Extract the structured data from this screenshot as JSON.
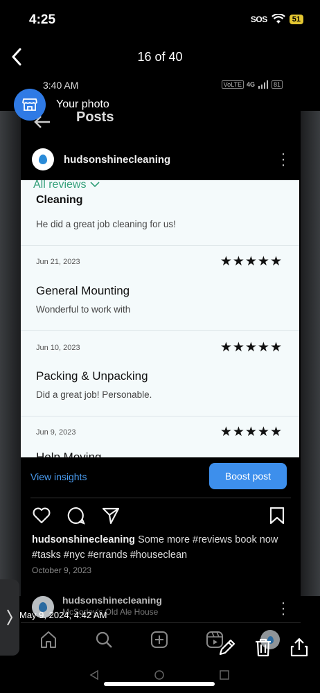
{
  "ios_status": {
    "time": "4:25",
    "sos": "SOS",
    "battery": "51"
  },
  "viewer": {
    "counter": "16 of 40"
  },
  "your_photo": {
    "label": "Your photo"
  },
  "screenshot": {
    "status_time": "3:40 AM",
    "status_icons": [
      "VoLTE",
      "4G",
      "81"
    ],
    "posts_title": "Posts",
    "profile_name": "hudsonshinecleaning",
    "reviews": {
      "tab_label": "All reviews",
      "clipped_title": "Cleaning",
      "first_text": "He did a great job cleaning for us!",
      "items": [
        {
          "date": "Jun 21, 2023",
          "stars": "★★★★★",
          "title": "General Mounting",
          "text": "Wonderful to work with"
        },
        {
          "date": "Jun 10, 2023",
          "stars": "★★★★★",
          "title": "Packing & Unpacking",
          "text": "Did a great job! Personable."
        },
        {
          "date": "Jun 9, 2023",
          "stars": "★★★★★",
          "title": "Help Moving",
          "text": ""
        }
      ]
    },
    "view_insights": "View insights",
    "boost_post": "Boost post",
    "caption_user": "hudsonshinecleaning",
    "caption_text": " Some more #reviews book now #tasks #nyc #errands #houseclean",
    "post_date": "October 9, 2023",
    "next_post": {
      "name": "hudsonshinecleaning",
      "location": "McSorley's Old Ale House"
    }
  },
  "timestamp": "May 9, 2024, 4:42 AM",
  "colors": {
    "accent_blue": "#3d8fec",
    "review_green": "#34a07a",
    "photo_badge": "#2f7ae5"
  }
}
